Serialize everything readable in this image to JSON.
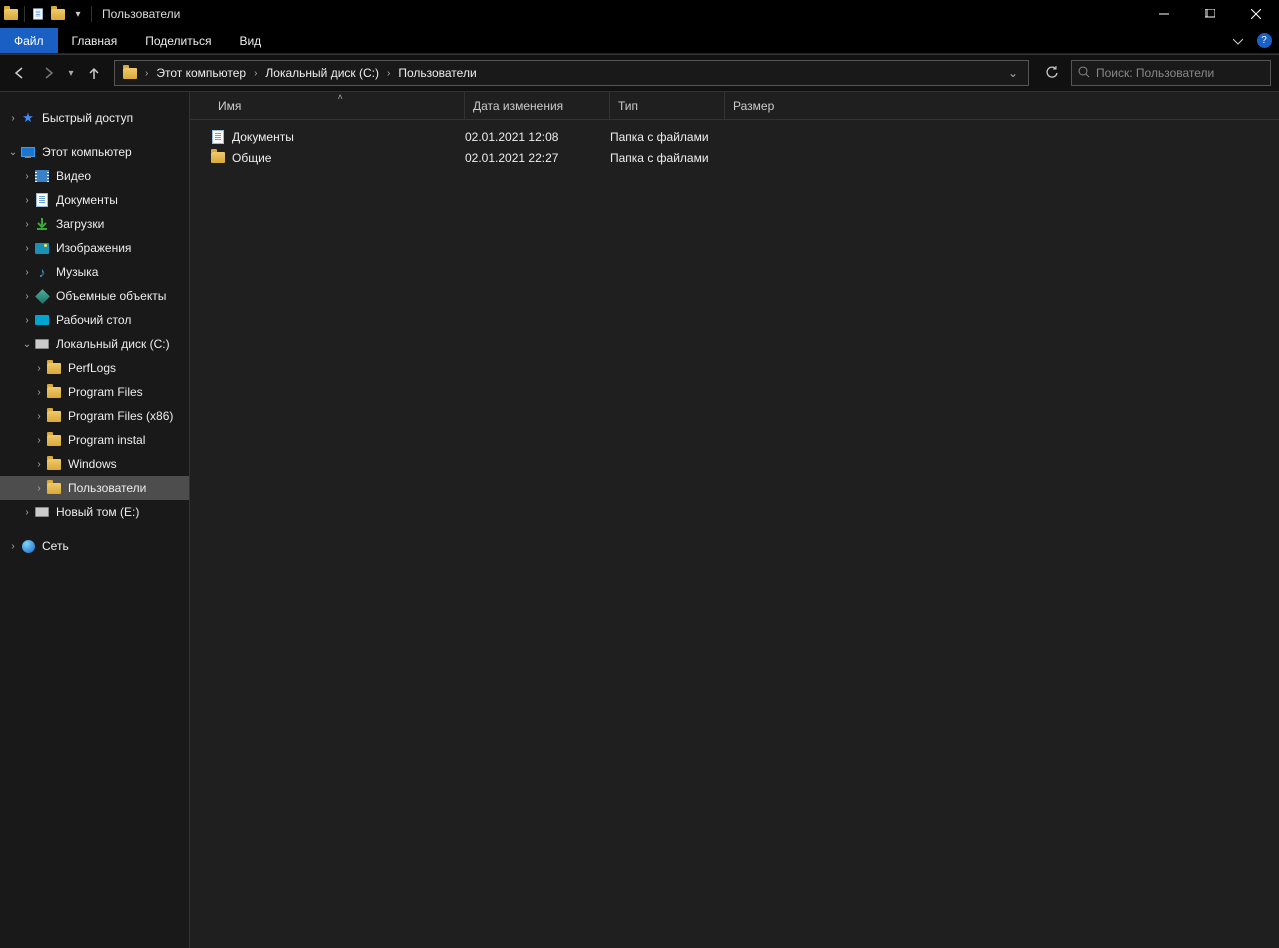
{
  "title": "Пользователи",
  "ribbon": {
    "file": "Файл",
    "home": "Главная",
    "share": "Поделиться",
    "view": "Вид"
  },
  "breadcrumb": [
    "Этот компьютер",
    "Локальный диск (C:)",
    "Пользователи"
  ],
  "search_placeholder": "Поиск: Пользователи",
  "columns": {
    "name": "Имя",
    "date": "Дата изменения",
    "type": "Тип",
    "size": "Размер"
  },
  "column_widths": {
    "name": 255,
    "date": 145,
    "type": 115,
    "size": 80
  },
  "files": [
    {
      "icon": "doc",
      "name": "Документы",
      "date": "02.01.2021 12:08",
      "type": "Папка с файлами",
      "size": ""
    },
    {
      "icon": "folder",
      "name": "Общие",
      "date": "02.01.2021 22:27",
      "type": "Папка с файлами",
      "size": ""
    }
  ],
  "sidebar": {
    "quick": "Быстрый доступ",
    "pc": "Этот компьютер",
    "pc_children": [
      {
        "icon": "vid",
        "label": "Видео"
      },
      {
        "icon": "doc",
        "label": "Документы"
      },
      {
        "icon": "dl",
        "label": "Загрузки"
      },
      {
        "icon": "pic",
        "label": "Изображения"
      },
      {
        "icon": "music",
        "label": "Музыка"
      },
      {
        "icon": "cube",
        "label": "Объемные объекты"
      },
      {
        "icon": "desk",
        "label": "Рабочий стол"
      }
    ],
    "drive_c": "Локальный диск (C:)",
    "drive_c_children": [
      "PerfLogs",
      "Program Files",
      "Program Files (x86)",
      "Program instal",
      "Windows",
      "Пользователи"
    ],
    "drive_e": "Новый том (E:)",
    "network": "Сеть"
  }
}
